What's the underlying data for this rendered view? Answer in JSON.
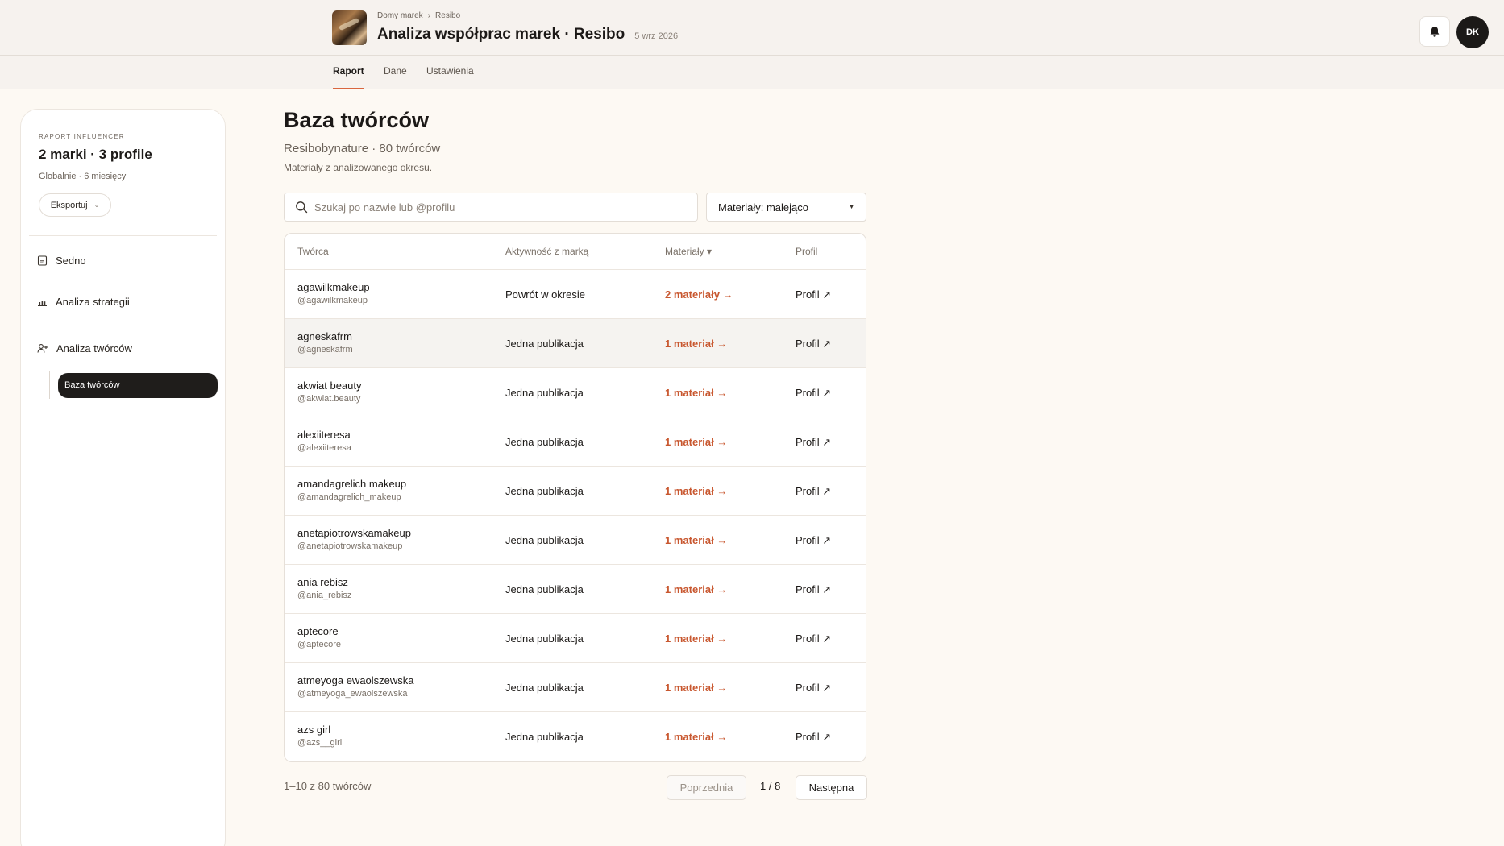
{
  "header": {
    "breadcrumb": [
      "Domy marek",
      "Resibo"
    ],
    "breadcrumb_sep": "›",
    "title": "Analiza współprac marek · Resibo",
    "date": "5 wrz 2026",
    "avatar_initials": "DK",
    "bell_icon": "bell-icon"
  },
  "tabs": [
    {
      "label": "Raport",
      "active": true
    },
    {
      "label": "Dane",
      "active": false
    },
    {
      "label": "Ustawienia",
      "active": false
    }
  ],
  "sidebar": {
    "eyebrow": "RAPORT INFLUENCER",
    "title": "2 marki · 3 profile",
    "subtitle": "Globalnie · 6 miesięcy",
    "export_label": "Eksportuj",
    "items": [
      {
        "label": "Sedno",
        "icon": "document-icon"
      },
      {
        "label": "Analiza strategii",
        "icon": "bar-chart-icon"
      },
      {
        "label": "Analiza twórców",
        "icon": "user-plus-icon"
      }
    ],
    "sub_item_active": "Baza twórców"
  },
  "main": {
    "title": "Baza twórców",
    "subtitle": "Resibobynature · 80 twórców",
    "description": "Materiały z analizowanego okresu.",
    "search_placeholder": "Szukaj po nazwie lub @profilu",
    "sort_label": "Materiały: malejąco",
    "sort_caret": "▼",
    "columns": {
      "creator": "Twórca",
      "activity": "Aktywność z marką",
      "materials": "Materiały ▾",
      "profile": "Profil"
    },
    "rows": [
      {
        "name": "agawilkmakeup",
        "handle": "@agawilkmakeup",
        "activity": "Powrót w okresie",
        "materials": "2 materiały →",
        "profile": "Profil ↗"
      },
      {
        "name": "agneskafrm",
        "handle": "@agneskafrm",
        "activity": "Jedna publikacja",
        "materials": "1 materiał →",
        "profile": "Profil ↗"
      },
      {
        "name": "akwiat beauty",
        "handle": "@akwiat.beauty",
        "activity": "Jedna publikacja",
        "materials": "1 materiał →",
        "profile": "Profil ↗"
      },
      {
        "name": "alexiiteresa",
        "handle": "@alexiiteresa",
        "activity": "Jedna publikacja",
        "materials": "1 materiał →",
        "profile": "Profil ↗"
      },
      {
        "name": "amandagrelich makeup",
        "handle": "@amandagrelich_makeup",
        "activity": "Jedna publikacja",
        "materials": "1 materiał →",
        "profile": "Profil ↗"
      },
      {
        "name": "anetapiotrowskamakeup",
        "handle": "@anetapiotrowskamakeup",
        "activity": "Jedna publikacja",
        "materials": "1 materiał →",
        "profile": "Profil ↗"
      },
      {
        "name": "ania rebisz",
        "handle": "@ania_rebisz",
        "activity": "Jedna publikacja",
        "materials": "1 materiał →",
        "profile": "Profil ↗"
      },
      {
        "name": "aptecore",
        "handle": "@aptecore",
        "activity": "Jedna publikacja",
        "materials": "1 materiał →",
        "profile": "Profil ↗"
      },
      {
        "name": "atmeyoga ewaolszewska",
        "handle": "@atmeyoga_ewaolszewska",
        "activity": "Jedna publikacja",
        "materials": "1 materiał →",
        "profile": "Profil ↗"
      },
      {
        "name": "azs girl",
        "handle": "@azs__girl",
        "activity": "Jedna publikacja",
        "materials": "1 materiał →",
        "profile": "Profil ↗"
      }
    ],
    "pagination": {
      "count_label": "1–10 z 80 twórców",
      "prev_label": "Poprzednia",
      "page_label": "1 / 8",
      "next_label": "Następna"
    }
  },
  "colors": {
    "accent": "#c8572f",
    "tab_underline": "#d9663f",
    "dark": "#1f1d1b",
    "page_bg": "#fdf9f3"
  }
}
